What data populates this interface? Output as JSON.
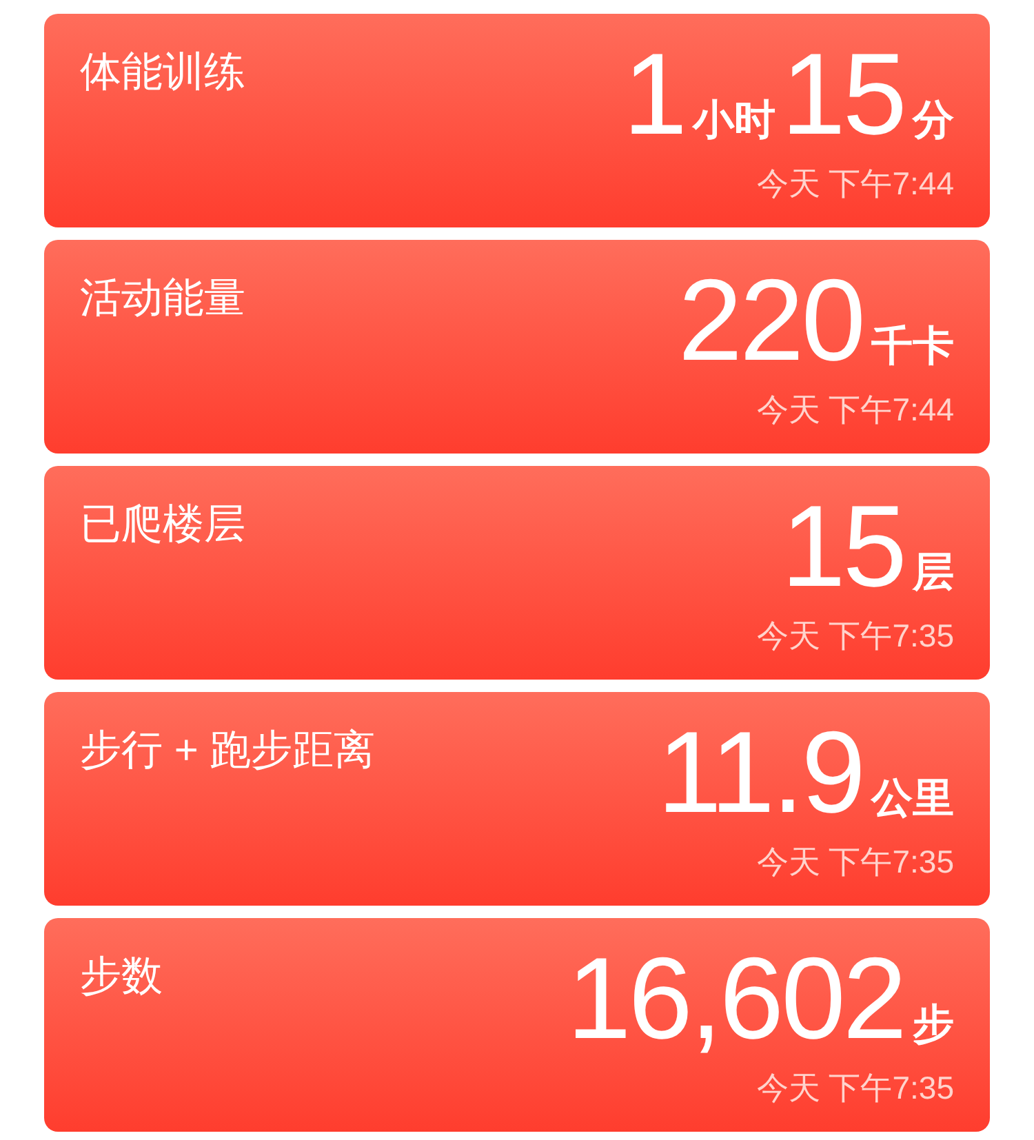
{
  "cards": [
    {
      "title": "体能训练",
      "value": [
        {
          "kind": "number",
          "text": "1"
        },
        {
          "kind": "unit",
          "text": "小时"
        },
        {
          "kind": "number",
          "text": "15"
        },
        {
          "kind": "unit",
          "text": "分"
        }
      ],
      "time": "今天 下午7:44"
    },
    {
      "title": "活动能量",
      "value": [
        {
          "kind": "number",
          "text": "220"
        },
        {
          "kind": "unit",
          "text": "千卡"
        }
      ],
      "time": "今天 下午7:44"
    },
    {
      "title": "已爬楼层",
      "value": [
        {
          "kind": "number",
          "text": "15"
        },
        {
          "kind": "unit",
          "text": "层"
        }
      ],
      "time": "今天 下午7:35"
    },
    {
      "title": "步行 + 跑步距离",
      "value": [
        {
          "kind": "number",
          "text": "11.9"
        },
        {
          "kind": "unit",
          "text": "公里"
        }
      ],
      "time": "今天 下午7:35"
    },
    {
      "title": "步数",
      "value": [
        {
          "kind": "number",
          "text": "16,602"
        },
        {
          "kind": "unit",
          "text": "步"
        }
      ],
      "time": "今天 下午7:35"
    }
  ]
}
